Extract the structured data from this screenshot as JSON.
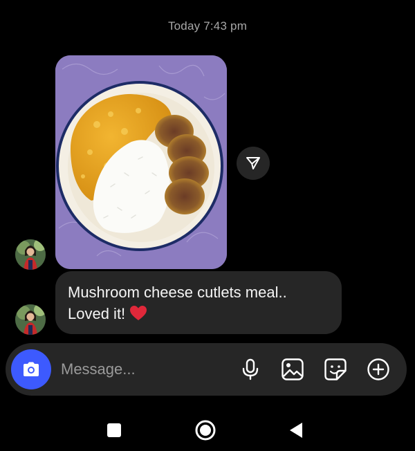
{
  "conversation": {
    "timestamp": "Today 7:43 pm"
  },
  "messages": [
    {
      "type": "photo",
      "description_icon": "food-photo"
    },
    {
      "type": "text",
      "lines": [
        "Mushroom cheese cutlets meal..",
        "Loved it!"
      ],
      "emoji_icon": "red-heart-icon"
    }
  ],
  "composer": {
    "placeholder": "Message...",
    "icons": [
      "camera-icon",
      "microphone-icon",
      "gallery-icon",
      "sticker-icon",
      "plus-icon"
    ]
  },
  "colors": {
    "background": "#000000",
    "bubble": "#262626",
    "camera_accent": "#3d5afe",
    "timestamp": "#a8a8a8",
    "heart": "#e0283a"
  }
}
